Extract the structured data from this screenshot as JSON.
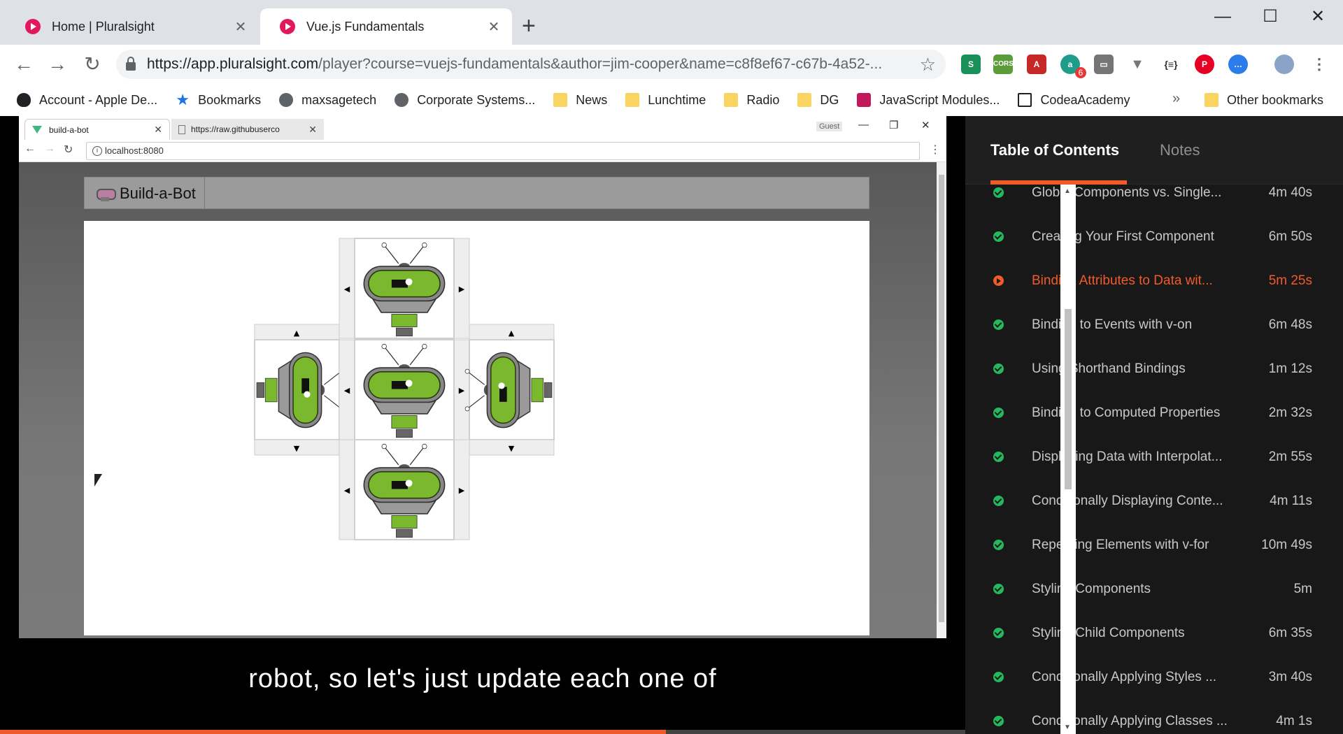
{
  "browser": {
    "tabs": [
      {
        "title": "Home | Pluralsight"
      },
      {
        "title": "Vue.js Fundamentals"
      }
    ],
    "url_host": "https://app.pluralsight.com",
    "url_path": "/player?course=vuejs-fundamentals&author=jim-cooper&name=c8f8ef67-c67b-4a52-...",
    "extension_badge": "6",
    "bookmarks": [
      {
        "label": "Account - Apple De...",
        "icon": "apple-icon"
      },
      {
        "label": "Bookmarks",
        "icon": "star-icon"
      },
      {
        "label": "maxsagetech",
        "icon": "globe-icon"
      },
      {
        "label": "Corporate Systems...",
        "icon": "globe-icon"
      },
      {
        "label": "News",
        "icon": "folder-icon"
      },
      {
        "label": "Lunchtime",
        "icon": "folder-icon"
      },
      {
        "label": "Radio",
        "icon": "folder-icon"
      },
      {
        "label": "DG",
        "icon": "folder-icon"
      },
      {
        "label": "JavaScript Modules...",
        "icon": "site-icon"
      },
      {
        "label": "CodeaAcademy",
        "icon": "site-icon"
      }
    ],
    "overflow": "»",
    "other_bookmarks": "Other bookmarks"
  },
  "inner_browser": {
    "tabs": [
      {
        "title": "build-a-bot"
      },
      {
        "title": "https://raw.githubuserco"
      }
    ],
    "guest": "Guest",
    "url": "localhost:8080",
    "app_title": "Build-a-Bot"
  },
  "video": {
    "caption": "robot, so let's just update each one of",
    "progress_percent": 69
  },
  "sidebar": {
    "tabs": [
      "Table of Contents",
      "Notes"
    ],
    "items": [
      {
        "title": "Global Components vs. Single...",
        "duration": "4m 40s",
        "status": "done"
      },
      {
        "title": "Creating Your First Component",
        "duration": "6m 50s",
        "status": "done"
      },
      {
        "title": "Binding Attributes to Data wit...",
        "duration": "5m 25s",
        "status": "playing"
      },
      {
        "title": "Binding to Events with v-on",
        "duration": "6m 48s",
        "status": "done"
      },
      {
        "title": "Using Shorthand Bindings",
        "duration": "1m 12s",
        "status": "done"
      },
      {
        "title": "Binding to Computed Properties",
        "duration": "2m 32s",
        "status": "done"
      },
      {
        "title": "Displaying Data with Interpolat...",
        "duration": "2m 55s",
        "status": "done"
      },
      {
        "title": "Conditionally Displaying Conte...",
        "duration": "4m 11s",
        "status": "done"
      },
      {
        "title": "Repeating Elements with v-for",
        "duration": "10m 49s",
        "status": "done"
      },
      {
        "title": "Styling Components",
        "duration": "5m",
        "status": "done"
      },
      {
        "title": "Styling Child Components",
        "duration": "6m 35s",
        "status": "done"
      },
      {
        "title": "Conditionally Applying Styles ...",
        "duration": "3m 40s",
        "status": "done"
      },
      {
        "title": "Conditionally Applying Classes ...",
        "duration": "4m 1s",
        "status": "done"
      }
    ]
  },
  "colors": {
    "accent": "#f15b2a",
    "done": "#25b95f",
    "robot_green": "#7ab82e"
  }
}
